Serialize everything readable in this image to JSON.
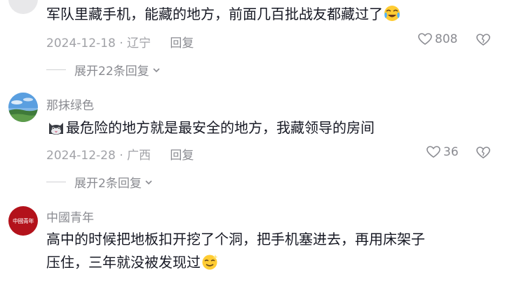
{
  "comments": [
    {
      "text": "军队里藏手机，能藏的地方，前面几百批战友都藏过了",
      "emoji": "laugh-cry-emoji",
      "date": "2024-12-18",
      "sep": "·",
      "location": "辽宁",
      "reply_label": "回复",
      "likes": "808",
      "expand_label": "展开22条回复"
    },
    {
      "username": "那抹绿色",
      "emoji": "cat-emoji",
      "text": "最危险的地方就是最安全的地方，我藏领导的房间",
      "date": "2024-12-28",
      "sep": "·",
      "location": "广西",
      "reply_label": "回复",
      "likes": "36",
      "expand_label": "展开2条回复"
    },
    {
      "username": "中國青年",
      "avatar_text": "中國青年",
      "text_line1": "高中的时候把地板扣开挖了个洞，把手机塞进去，再用床架子",
      "text_line2": "压住，三年就没被发现过",
      "emoji": "sly-smile-emoji"
    }
  ],
  "colors": {
    "text": "#161823",
    "secondary": "#8a8b91",
    "avatar_red": "#b3121b"
  }
}
